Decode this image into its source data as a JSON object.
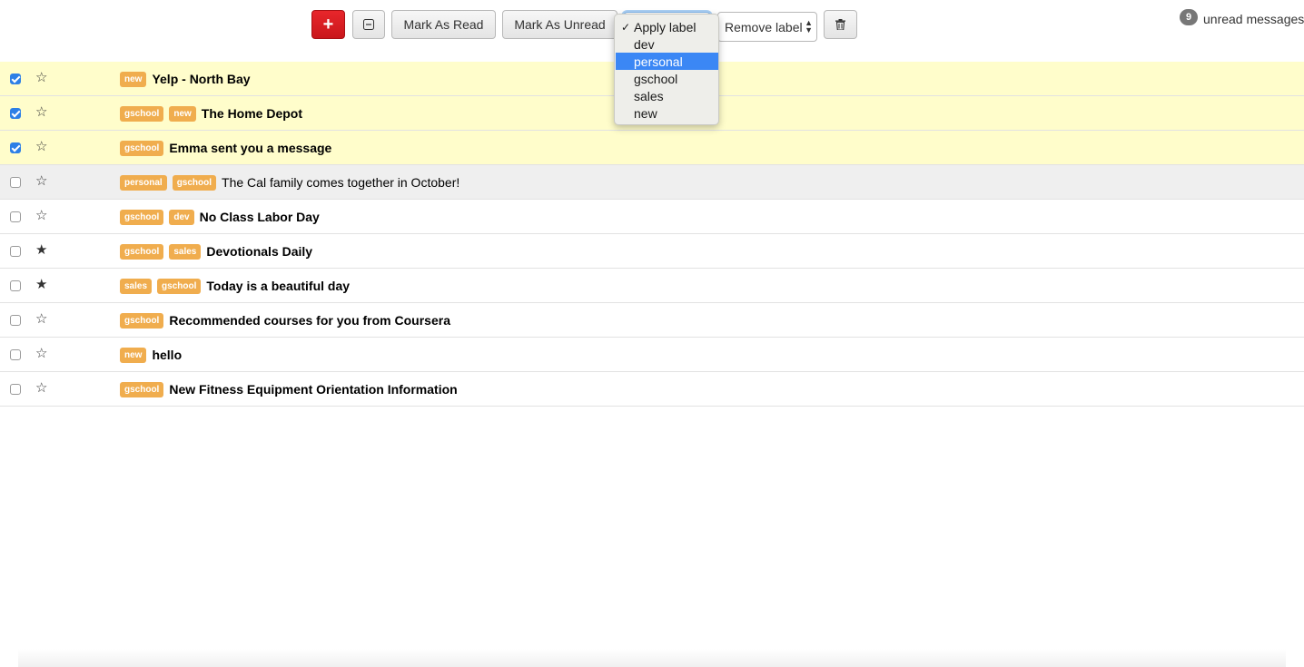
{
  "toolbar": {
    "compose_icon": "plus-icon",
    "select_icon": "minus-square-icon",
    "mark_read_label": "Mark As Read",
    "mark_unread_label": "Mark As Unread",
    "remove_label_value": "Remove label",
    "delete_icon": "trash-icon",
    "unread_count": "9",
    "unread_text": "unread messages"
  },
  "apply_label_menu": {
    "items": [
      {
        "label": "Apply label",
        "checked": true,
        "highlighted": false
      },
      {
        "label": "dev",
        "checked": false,
        "highlighted": false
      },
      {
        "label": "personal",
        "checked": false,
        "highlighted": true
      },
      {
        "label": "gschool",
        "checked": false,
        "highlighted": false
      },
      {
        "label": "sales",
        "checked": false,
        "highlighted": false
      },
      {
        "label": "new",
        "checked": false,
        "highlighted": false
      }
    ]
  },
  "messages": [
    {
      "selected": true,
      "starred": false,
      "read": false,
      "labels": [
        "new"
      ],
      "subject": "Yelp - North Bay"
    },
    {
      "selected": true,
      "starred": false,
      "read": false,
      "labels": [
        "gschool",
        "new"
      ],
      "subject": "The Home Depot"
    },
    {
      "selected": true,
      "starred": false,
      "read": false,
      "labels": [
        "gschool"
      ],
      "subject": "Emma sent you a message"
    },
    {
      "selected": false,
      "starred": false,
      "read": true,
      "labels": [
        "personal",
        "gschool"
      ],
      "subject": "The Cal family comes together in October!"
    },
    {
      "selected": false,
      "starred": false,
      "read": false,
      "labels": [
        "gschool",
        "dev"
      ],
      "subject": "No Class Labor Day"
    },
    {
      "selected": false,
      "starred": true,
      "read": false,
      "labels": [
        "gschool",
        "sales"
      ],
      "subject": "Devotionals Daily"
    },
    {
      "selected": false,
      "starred": true,
      "read": false,
      "labels": [
        "sales",
        "gschool"
      ],
      "subject": "Today is a beautiful day"
    },
    {
      "selected": false,
      "starred": false,
      "read": false,
      "labels": [
        "gschool"
      ],
      "subject": "Recommended courses for you from Coursera"
    },
    {
      "selected": false,
      "starred": false,
      "read": false,
      "labels": [
        "new"
      ],
      "subject": "hello"
    },
    {
      "selected": false,
      "starred": false,
      "read": false,
      "labels": [
        "gschool"
      ],
      "subject": "New Fitness Equipment Orientation Information"
    }
  ],
  "colors": {
    "label_bg": "#f0ad4e",
    "selected_row": "#fffdcb",
    "read_row": "#efefef",
    "compose_button": "#d9534f",
    "menu_highlight": "#3b87f5"
  }
}
